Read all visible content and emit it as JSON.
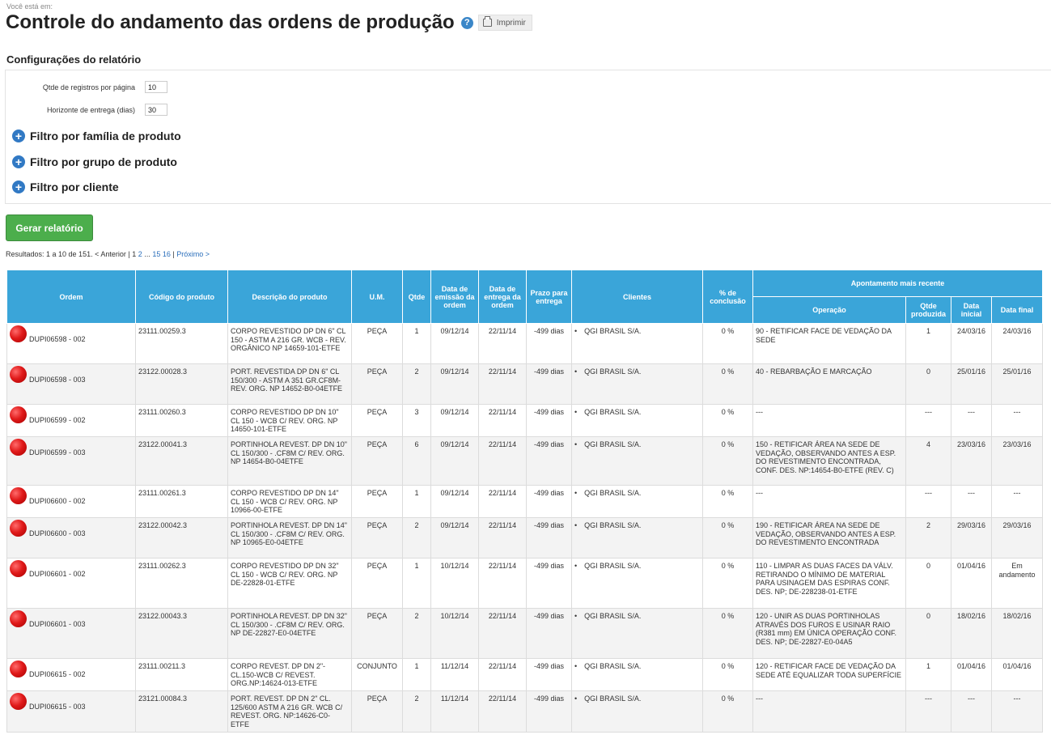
{
  "breadcrumb": "Você está em:",
  "page_title": "Controle do andamento das ordens de produção",
  "help_icon": "?",
  "print_label": "Imprimir",
  "config": {
    "title": "Configurações do relatório",
    "records_label": "Qtde de registros por página",
    "records_value": "10",
    "horizon_label": "Horizonte de entrega (dias)",
    "horizon_value": "30",
    "filters": [
      "Filtro por família de produto",
      "Filtro por grupo de produto",
      "Filtro por cliente"
    ]
  },
  "generate_label": "Gerar relatório",
  "pager": {
    "results": "Resultados: 1 a 10 de 151.",
    "prev": "< Anterior",
    "sep": "|",
    "current": "1",
    "p2": "2",
    "ellipsis": "...",
    "p15": "15",
    "p16": "16",
    "sep2": "|",
    "next": "Próximo >"
  },
  "table": {
    "headers": {
      "ordem": "Ordem",
      "codigo": "Código do produto",
      "descricao": "Descrição do produto",
      "um": "U.M.",
      "qtde": "Qtde",
      "emissao": "Data de emissão da ordem",
      "entrega": "Data de entrega da ordem",
      "prazo": "Prazo para entrega",
      "clientes": "Clientes",
      "conclusao": "% de conclusão",
      "apontamento": "Apontamento mais recente",
      "operacao": "Operação",
      "qtde_produzida": "Qtde produzida",
      "data_inicial": "Data inicial",
      "data_final": "Data final"
    },
    "rows": [
      {
        "ordem": "DUPI06598 - 002",
        "codigo": "23111.00259.3",
        "descricao": "CORPO REVESTIDO DP DN 6\" CL 150 - ASTM A 216 GR. WCB - REV. ORGÂNICO NP 14659-101-ETFE",
        "um": "PEÇA",
        "qtde": "1",
        "emissao": "09/12/14",
        "entrega": "22/11/14",
        "prazo": "-499 dias",
        "cliente": "QGI BRASIL S/A.",
        "conclusao": "0 %",
        "operacao": "90 - RETIFICAR FACE DE VEDAÇÃO DA SEDE",
        "qtde_produzida": "1",
        "data_inicial": "24/03/16",
        "data_final": "24/03/16"
      },
      {
        "ordem": "DUPI06598 - 003",
        "codigo": "23122.00028.3",
        "descricao": "PORT. REVESTIDA DP DN 6\" CL 150/300 - ASTM A 351 GR.CF8M- REV. ORG. NP 14652-B0-04ETFE",
        "um": "PEÇA",
        "qtde": "2",
        "emissao": "09/12/14",
        "entrega": "22/11/14",
        "prazo": "-499 dias",
        "cliente": "QGI BRASIL S/A.",
        "conclusao": "0 %",
        "operacao": "40 - REBARBAÇÃO E MARCAÇÃO",
        "qtde_produzida": "0",
        "data_inicial": "25/01/16",
        "data_final": "25/01/16"
      },
      {
        "ordem": "DUPI06599 - 002",
        "codigo": "23111.00260.3",
        "descricao": "CORPO REVESTIDO DP DN 10\" CL 150 - WCB C/ REV. ORG. NP 14650-101-ETFE",
        "um": "PEÇA",
        "qtde": "3",
        "emissao": "09/12/14",
        "entrega": "22/11/14",
        "prazo": "-499 dias",
        "cliente": "QGI BRASIL S/A.",
        "conclusao": "0 %",
        "operacao": "---",
        "qtde_produzida": "---",
        "data_inicial": "---",
        "data_final": "---"
      },
      {
        "ordem": "DUPI06599 - 003",
        "codigo": "23122.00041.3",
        "descricao": "PORTINHOLA REVEST. DP DN 10\" CL 150/300 - .CF8M C/ REV. ORG. NP 14654-B0-04ETFE",
        "um": "PEÇA",
        "qtde": "6",
        "emissao": "09/12/14",
        "entrega": "22/11/14",
        "prazo": "-499 dias",
        "cliente": "QGI BRASIL S/A.",
        "conclusao": "0 %",
        "operacao": "150 - RETIFICAR ÁREA NA SEDE DE VEDAÇÃO, OBSERVANDO ANTES A ESP. DO REVESTIMENTO ENCONTRADA, CONF. DES. NP:14654-B0-ETFE (REV. C)",
        "qtde_produzida": "4",
        "data_inicial": "23/03/16",
        "data_final": "23/03/16"
      },
      {
        "ordem": "DUPI06600 - 002",
        "codigo": "23111.00261.3",
        "descricao": "CORPO REVESTIDO DP DN 14\" CL 150 - WCB C/ REV. ORG. NP 10966-00-ETFE",
        "um": "PEÇA",
        "qtde": "1",
        "emissao": "09/12/14",
        "entrega": "22/11/14",
        "prazo": "-499 dias",
        "cliente": "QGI BRASIL S/A.",
        "conclusao": "0 %",
        "operacao": "---",
        "qtde_produzida": "---",
        "data_inicial": "---",
        "data_final": "---"
      },
      {
        "ordem": "DUPI06600 - 003",
        "codigo": "23122.00042.3",
        "descricao": "PORTINHOLA REVEST. DP DN 14\" CL 150/300 - .CF8M C/ REV. ORG. NP 10965-E0-04ETFE",
        "um": "PEÇA",
        "qtde": "2",
        "emissao": "09/12/14",
        "entrega": "22/11/14",
        "prazo": "-499 dias",
        "cliente": "QGI BRASIL S/A.",
        "conclusao": "0 %",
        "operacao": "190 - RETIFICAR ÁREA NA SEDE DE VEDAÇÃO, OBSERVANDO ANTES A ESP. DO REVESTIMENTO ENCONTRADA",
        "qtde_produzida": "2",
        "data_inicial": "29/03/16",
        "data_final": "29/03/16"
      },
      {
        "ordem": "DUPI06601 - 002",
        "codigo": "23111.00262.3",
        "descricao": "CORPO REVESTIDO DP DN 32\" CL 150 - WCB C/ REV. ORG. NP DE-22828-01-ETFE",
        "um": "PEÇA",
        "qtde": "1",
        "emissao": "10/12/14",
        "entrega": "22/11/14",
        "prazo": "-499 dias",
        "cliente": "QGI BRASIL S/A.",
        "conclusao": "0 %",
        "operacao": "110 - LIMPAR AS DUAS FACES DA VÁLV. RETIRANDO O MÍNIMO DE MATERIAL PARA USINAGEM DAS ESPIRAS CONF. DES. NP; DE-228238-01-ETFE",
        "qtde_produzida": "0",
        "data_inicial": "01/04/16",
        "data_final": "Em andamento"
      },
      {
        "ordem": "DUPI06601 - 003",
        "codigo": "23122.00043.3",
        "descricao": "PORTINHOLA REVEST. DP DN 32\" CL 150/300 - .CF8M C/ REV. ORG. NP DE-22827-E0-04ETFE",
        "um": "PEÇA",
        "qtde": "2",
        "emissao": "10/12/14",
        "entrega": "22/11/14",
        "prazo": "-499 dias",
        "cliente": "QGI BRASIL S/A.",
        "conclusao": "0 %",
        "operacao": "120 - UNIR AS DUAS PORTINHOLAS ATRAVÉS DOS FUROS E USINAR RAIO (R381 mm) EM ÚNICA OPERAÇÃO CONF. DES. NP; DE-22827-E0-04A5",
        "qtde_produzida": "0",
        "data_inicial": "18/02/16",
        "data_final": "18/02/16"
      },
      {
        "ordem": "DUPI06615 - 002",
        "codigo": "23111.00211.3",
        "descricao": "CORPO REVEST. DP DN 2\"-CL.150-WCB C/ REVEST. ORG.NP:14624-013-ETFE",
        "um": "CONJUNTO",
        "qtde": "1",
        "emissao": "11/12/14",
        "entrega": "22/11/14",
        "prazo": "-499 dias",
        "cliente": "QGI BRASIL S/A.",
        "conclusao": "0 %",
        "operacao": "120 - RETIFICAR FACE DE VEDAÇÃO DA SEDE ATÉ EQUALIZAR TODA SUPERFÍCIE",
        "qtde_produzida": "1",
        "data_inicial": "01/04/16",
        "data_final": "01/04/16"
      },
      {
        "ordem": "DUPI06615 - 003",
        "codigo": "23121.00084.3",
        "descricao": "PORT. REVEST. DP DN 2\" CL. 125/600 ASTM A 216 GR. WCB C/ REVEST. ORG. NP:14626-C0-ETFE",
        "um": "PEÇA",
        "qtde": "2",
        "emissao": "11/12/14",
        "entrega": "22/11/14",
        "prazo": "-499 dias",
        "cliente": "QGI BRASIL S/A.",
        "conclusao": "0 %",
        "operacao": "---",
        "qtde_produzida": "---",
        "data_inicial": "---",
        "data_final": "---"
      }
    ]
  },
  "status_icon": "red-circle-icon",
  "colors": {
    "header_bg": "#3aa5d9",
    "button_green": "#4cae4c",
    "status_red": "#e01a1a",
    "link": "#2a6ebb"
  }
}
